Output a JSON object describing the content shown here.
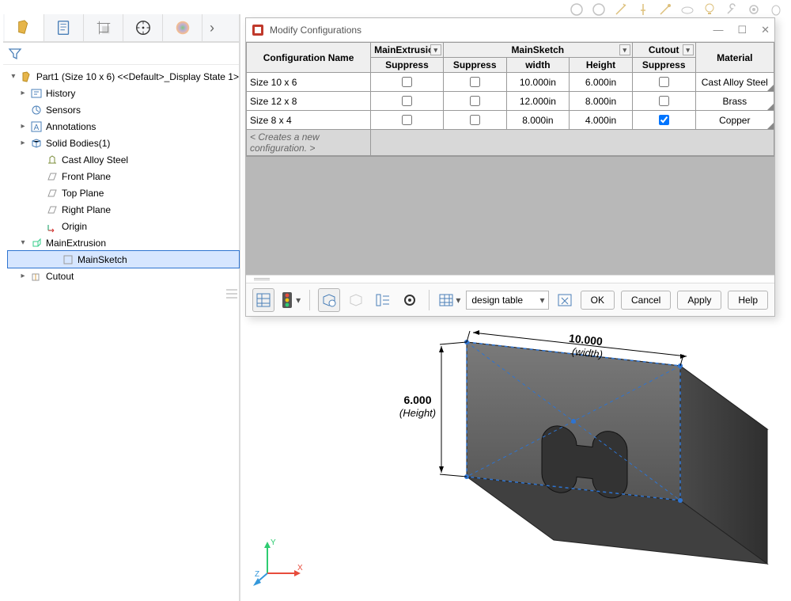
{
  "top_toolbar_icons": [
    "save-icon",
    "print-icon",
    "pin-icon",
    "pushpin-icon",
    "magic-icon",
    "undo-icon",
    "light-icon",
    "wrench-icon",
    "gear-icon",
    "beetle-icon"
  ],
  "panel_tabs": [
    {
      "name": "feature-manager-tab",
      "active": true
    },
    {
      "name": "property-manager-tab",
      "active": false
    },
    {
      "name": "configuration-manager-tab",
      "active": false
    },
    {
      "name": "dimxpert-tab",
      "active": false
    },
    {
      "name": "display-manager-tab",
      "active": false
    }
  ],
  "tree": {
    "root_label": "Part1 (Size 10 x 6) <<Default>_Display State 1>",
    "items": [
      {
        "label": "History",
        "exp": "▸",
        "icon": "history-icon"
      },
      {
        "label": "Sensors",
        "exp": "",
        "icon": "sensors-icon"
      },
      {
        "label": "Annotations",
        "exp": "▸",
        "icon": "annotations-icon"
      },
      {
        "label": "Solid Bodies(1)",
        "exp": "▸",
        "icon": "solid-bodies-icon"
      },
      {
        "label": "Cast Alloy Steel",
        "exp": "",
        "icon": "material-icon"
      },
      {
        "label": "Front Plane",
        "exp": "",
        "icon": "plane-icon"
      },
      {
        "label": "Top Plane",
        "exp": "",
        "icon": "plane-icon"
      },
      {
        "label": "Right Plane",
        "exp": "",
        "icon": "plane-icon"
      },
      {
        "label": "Origin",
        "exp": "",
        "icon": "origin-icon"
      },
      {
        "label": "MainExtrusion",
        "exp": "▾",
        "icon": "extrusion-icon"
      },
      {
        "label": "MainSketch",
        "exp": "",
        "icon": "sketch-icon",
        "level": 3,
        "selected": true
      },
      {
        "label": "Cutout",
        "exp": "▸",
        "icon": "cutout-icon"
      }
    ]
  },
  "dialog": {
    "title": "Modify Configurations",
    "columns": {
      "config_name": "Configuration Name",
      "main_extrusion": "MainExtrusion",
      "main_sketch": "MainSketch",
      "cutout": "Cutout",
      "material": "Material",
      "suppress": "Suppress",
      "width": "width",
      "height": "Height"
    },
    "rows": [
      {
        "name": "Size 10 x 6",
        "me_sup": false,
        "ms_sup": false,
        "width": "10.000in",
        "height": "6.000in",
        "cut_sup": false,
        "material": "Cast Alloy Steel"
      },
      {
        "name": "Size 12 x 8",
        "me_sup": false,
        "ms_sup": false,
        "width": "12.000in",
        "height": "8.000in",
        "cut_sup": false,
        "material": "Brass"
      },
      {
        "name": "Size 8 x 4",
        "me_sup": false,
        "ms_sup": false,
        "width": "8.000in",
        "height": "4.000in",
        "cut_sup": true,
        "material": "Copper"
      }
    ],
    "new_config_placeholder": "< Creates a new configuration. >",
    "select_value": "design table",
    "buttons": {
      "ok": "OK",
      "cancel": "Cancel",
      "apply": "Apply",
      "help": "Help"
    }
  },
  "viewport": {
    "dim_width": {
      "value": "10.000",
      "label": "(width)"
    },
    "dim_height": {
      "value": "6.000",
      "label": "(Height)"
    }
  }
}
